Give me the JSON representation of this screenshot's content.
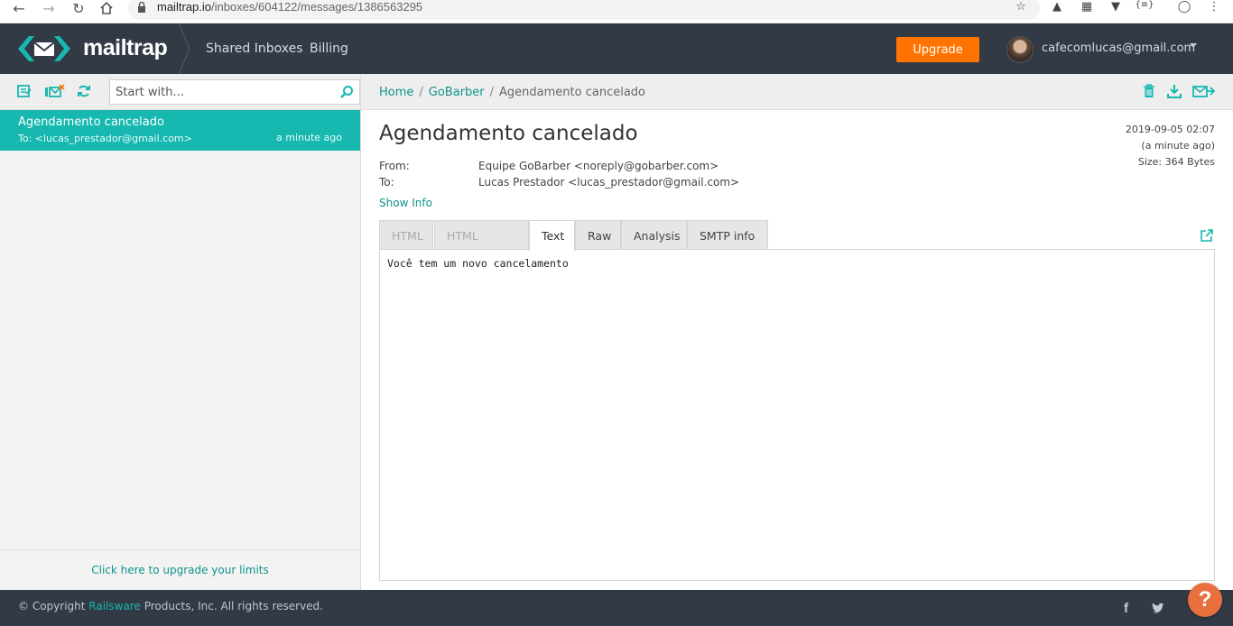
{
  "browser": {
    "url_host": "mailtrap.io",
    "url_path": "/inboxes/604122/messages/1386563295",
    "ext_badge": "{≡}"
  },
  "header": {
    "brand": "mailtrap",
    "nav": [
      "Shared Inboxes",
      "Billing"
    ],
    "upgrade_label": "Upgrade",
    "user_email": "cafecomlucas@gmail.com"
  },
  "sidebar": {
    "search_placeholder": "Start with...",
    "messages": [
      {
        "subject": "Agendamento cancelado",
        "to": "To: <lucas_prestador@gmail.com>",
        "time": "a minute ago"
      }
    ],
    "upgrade_link": "Click here to upgrade your limits"
  },
  "breadcrumb": {
    "home": "Home",
    "inbox": "GoBarber",
    "current": "Agendamento cancelado",
    "sep": "/"
  },
  "message": {
    "title": "Agendamento cancelado",
    "from_label": "From:",
    "from": "Equipe GoBarber <noreply@gobarber.com>",
    "to_label": "To:",
    "to": "Lucas Prestador <lucas_prestador@gmail.com>",
    "show_info": "Show Info",
    "date": "2019-09-05 02:07",
    "relative": "(a minute ago)",
    "size": "Size: 364 Bytes",
    "tabs": [
      "HTML",
      "HTML Source",
      "Text",
      "Raw",
      "Analysis",
      "SMTP info"
    ],
    "active_tab": "Text",
    "body": "Você tem um novo cancelamento"
  },
  "footer": {
    "copyright_prefix": "© Copyright",
    "brand": "Railsware",
    "copyright_suffix": "Products, Inc. All rights reserved.",
    "help": "?"
  },
  "colors": {
    "accent": "#16b8b0",
    "header": "#323a45",
    "upgrade": "#ff7300"
  }
}
